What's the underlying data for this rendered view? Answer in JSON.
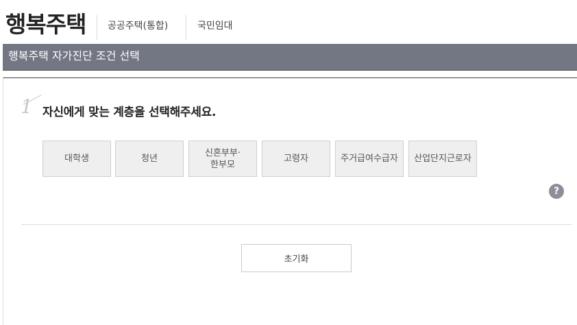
{
  "header": {
    "brand": "행복주택",
    "nav": [
      {
        "label": "공공주택(통합)"
      },
      {
        "label": "국민임대"
      }
    ]
  },
  "title_bar": {
    "title": "행복주택 자가진단 조건 선택"
  },
  "step": {
    "number": "1",
    "question": "자신에게 맞는 계층을 선택해주세요."
  },
  "options": [
    {
      "label": "대학생"
    },
    {
      "label": "청년"
    },
    {
      "label": "신혼부부·\n한부모"
    },
    {
      "label": "고령자"
    },
    {
      "label": "주거급여수급자"
    },
    {
      "label": "산업단지근로자"
    }
  ],
  "help": {
    "glyph": "?"
  },
  "reset_button": {
    "label": "초기화"
  },
  "colors": {
    "title_bar_bg": "#727783",
    "option_bg": "#efefef",
    "help_icon_bg": "#8c8f99"
  }
}
